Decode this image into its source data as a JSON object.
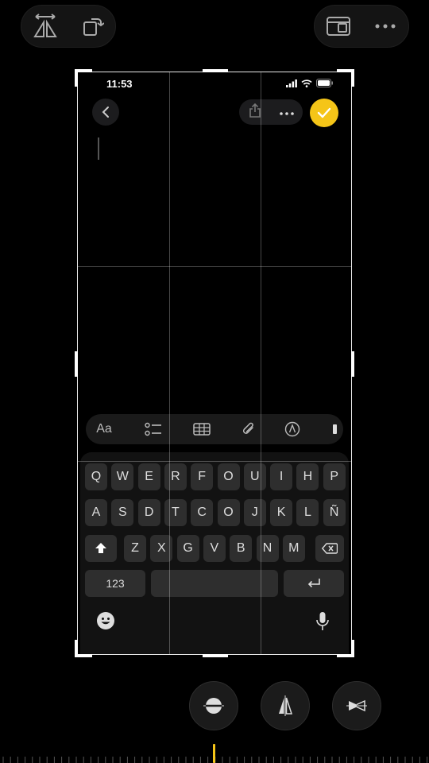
{
  "editor": {
    "toolbar_left": [
      "flip-horizontal-icon",
      "rotate-icon"
    ],
    "toolbar_right": [
      "aspect-ratio-icon",
      "more-icon"
    ],
    "bottom_controls": [
      "straighten-icon",
      "vertical-perspective-icon",
      "horizontal-perspective-icon"
    ],
    "accent_color": "#f5c518"
  },
  "phone": {
    "status": {
      "time": "11:53"
    },
    "notes_toolbar": {
      "back": "chevron-left-icon",
      "share": "share-icon",
      "more": "ellipsis-icon",
      "done": "checkmark-icon"
    },
    "format_bar": {
      "text_style_label": "Aa",
      "items": [
        "checklist-icon",
        "table-icon",
        "paperclip-icon",
        "markup-pen-icon"
      ]
    },
    "keyboard": {
      "row1": [
        "Q",
        "W",
        "E",
        "R",
        "F",
        "O",
        "U",
        "I",
        "H",
        "P"
      ],
      "row2": [
        "A",
        "S",
        "D",
        "T",
        "C",
        "O",
        "J",
        "K",
        "L",
        "Ñ"
      ],
      "row3": [
        "Z",
        "X",
        "G",
        "V",
        "B",
        "N",
        "M"
      ],
      "numbers_label": "123"
    }
  }
}
